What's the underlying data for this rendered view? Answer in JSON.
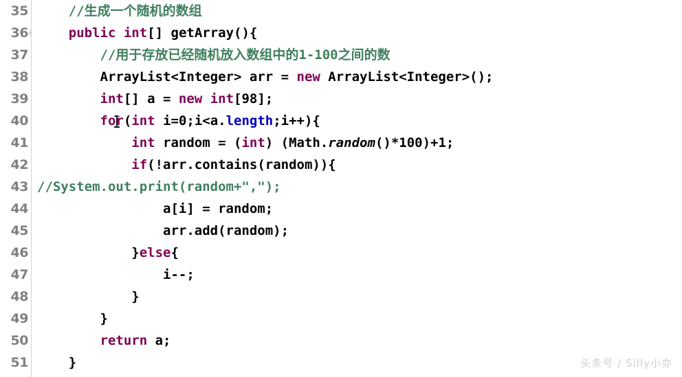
{
  "editor": {
    "background_color": "#ffffff",
    "gutter_color": "#808080",
    "colors": {
      "keyword": "#7f0055",
      "comment": "#3f7f5f",
      "field": "#0000c0",
      "text": "#000000"
    }
  },
  "watermark": {
    "text": "头条号 / Silly小亦"
  },
  "lines": [
    {
      "number": "35",
      "fold": false,
      "tokens": [
        {
          "text": "    ",
          "type": "plain"
        },
        {
          "text": "//生成一个随机的数组",
          "type": "comment"
        }
      ]
    },
    {
      "number": "36",
      "fold": true,
      "tokens": [
        {
          "text": "    ",
          "type": "plain"
        },
        {
          "text": "public",
          "type": "keyword"
        },
        {
          "text": " ",
          "type": "plain"
        },
        {
          "text": "int",
          "type": "keyword"
        },
        {
          "text": "[] getArray(){",
          "type": "plain"
        }
      ]
    },
    {
      "number": "37",
      "fold": false,
      "tokens": [
        {
          "text": "        ",
          "type": "plain"
        },
        {
          "text": "//用于存放已经随机放入数组中的1-100之间的数",
          "type": "comment"
        }
      ]
    },
    {
      "number": "38",
      "fold": false,
      "tokens": [
        {
          "text": "        ArrayList<Integer> arr = ",
          "type": "plain"
        },
        {
          "text": "new",
          "type": "keyword"
        },
        {
          "text": " ArrayList<Integer>();",
          "type": "plain"
        }
      ]
    },
    {
      "number": "39",
      "fold": false,
      "tokens": [
        {
          "text": "        ",
          "type": "plain"
        },
        {
          "text": "int",
          "type": "keyword"
        },
        {
          "text": "[] a = ",
          "type": "plain"
        },
        {
          "text": "new",
          "type": "keyword"
        },
        {
          "text": " ",
          "type": "plain"
        },
        {
          "text": "int",
          "type": "keyword"
        },
        {
          "text": "[98];",
          "type": "plain"
        }
      ]
    },
    {
      "number": "40",
      "fold": false,
      "tokens": [
        {
          "text": "        ",
          "type": "plain"
        },
        {
          "text": "for",
          "type": "keyword"
        },
        {
          "text": "(",
          "type": "plain"
        },
        {
          "text": "int",
          "type": "keyword"
        },
        {
          "text": " i=0;i<a.",
          "type": "plain"
        },
        {
          "text": "length",
          "type": "field"
        },
        {
          "text": ";i++){",
          "type": "plain"
        }
      ]
    },
    {
      "number": "41",
      "fold": false,
      "tokens": [
        {
          "text": "            ",
          "type": "plain"
        },
        {
          "text": "int",
          "type": "keyword"
        },
        {
          "text": " random = (",
          "type": "plain"
        },
        {
          "text": "int",
          "type": "keyword"
        },
        {
          "text": ") (Math.",
          "type": "plain"
        },
        {
          "text": "random",
          "type": "static"
        },
        {
          "text": "()*100)+1;",
          "type": "plain"
        }
      ]
    },
    {
      "number": "42",
      "fold": false,
      "tokens": [
        {
          "text": "            ",
          "type": "plain"
        },
        {
          "text": "if",
          "type": "keyword"
        },
        {
          "text": "(!arr.contains(random)){",
          "type": "plain"
        }
      ]
    },
    {
      "number": "43",
      "fold": false,
      "tokens": [
        {
          "text": "//System.out.print(random+\",\");",
          "type": "comment"
        }
      ]
    },
    {
      "number": "44",
      "fold": false,
      "tokens": [
        {
          "text": "                a[i] = random;",
          "type": "plain"
        }
      ]
    },
    {
      "number": "45",
      "fold": false,
      "tokens": [
        {
          "text": "                arr.add(random);",
          "type": "plain"
        }
      ]
    },
    {
      "number": "46",
      "fold": false,
      "tokens": [
        {
          "text": "            }",
          "type": "plain"
        },
        {
          "text": "else",
          "type": "keyword"
        },
        {
          "text": "{",
          "type": "plain"
        }
      ]
    },
    {
      "number": "47",
      "fold": false,
      "tokens": [
        {
          "text": "                i--;",
          "type": "plain"
        }
      ]
    },
    {
      "number": "48",
      "fold": false,
      "tokens": [
        {
          "text": "            }",
          "type": "plain"
        }
      ]
    },
    {
      "number": "49",
      "fold": false,
      "tokens": [
        {
          "text": "        }",
          "type": "plain"
        }
      ]
    },
    {
      "number": "50",
      "fold": false,
      "tokens": [
        {
          "text": "        ",
          "type": "plain"
        },
        {
          "text": "return",
          "type": "keyword"
        },
        {
          "text": " a;",
          "type": "plain"
        }
      ]
    },
    {
      "number": "51",
      "fold": false,
      "tokens": [
        {
          "text": "    }",
          "type": "plain"
        }
      ]
    }
  ]
}
